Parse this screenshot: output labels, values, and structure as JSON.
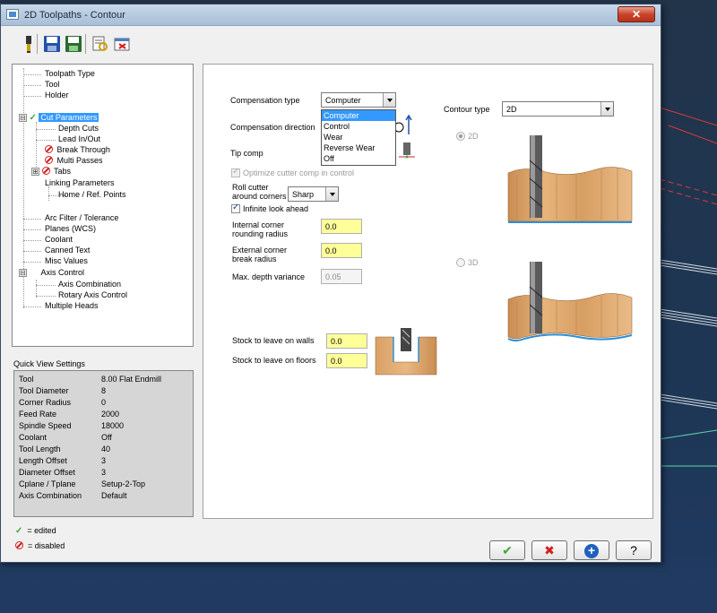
{
  "window": {
    "title": "2D Toolpaths - Contour",
    "close_label": "✕"
  },
  "toolbar": {
    "icons": [
      "tool-icon",
      "save-icon",
      "save-all-icon",
      "preview-icon",
      "calculator-icon"
    ]
  },
  "tree": {
    "items": [
      {
        "label": "Toolpath Type",
        "state": "none"
      },
      {
        "label": "Tool",
        "state": "none"
      },
      {
        "label": "Holder",
        "state": "none"
      },
      {
        "label": "Cut Parameters",
        "state": "edited",
        "selected": true,
        "expander": "⊟"
      },
      {
        "label": "Depth Cuts",
        "state": "none"
      },
      {
        "label": "Lead In/Out",
        "state": "none"
      },
      {
        "label": "Break Through",
        "state": "disabled"
      },
      {
        "label": "Multi Passes",
        "state": "disabled"
      },
      {
        "label": "Tabs",
        "state": "disabled",
        "expander": "⊞"
      },
      {
        "label": "Linking Parameters",
        "state": "none"
      },
      {
        "label": "Home / Ref. Points",
        "state": "none"
      },
      {
        "label": "Arc Filter / Tolerance",
        "state": "none"
      },
      {
        "label": "Planes (WCS)",
        "state": "none"
      },
      {
        "label": "Coolant",
        "state": "none"
      },
      {
        "label": "Canned Text",
        "state": "none"
      },
      {
        "label": "Misc Values",
        "state": "none"
      },
      {
        "label": "Axis Control",
        "state": "none",
        "expander": "⊟"
      },
      {
        "label": "Axis Combination",
        "state": "none"
      },
      {
        "label": "Rotary Axis Control",
        "state": "none"
      },
      {
        "label": "Multiple Heads",
        "state": "none"
      }
    ]
  },
  "quick_view": {
    "title": "Quick View Settings",
    "rows": [
      {
        "label": "Tool",
        "value": "8.00 Flat Endmill"
      },
      {
        "label": "Tool Diameter",
        "value": "8"
      },
      {
        "label": "Corner Radius",
        "value": "0"
      },
      {
        "label": "Feed Rate",
        "value": "2000"
      },
      {
        "label": "Spindle Speed",
        "value": "18000"
      },
      {
        "label": "Coolant",
        "value": "Off"
      },
      {
        "label": "Tool Length",
        "value": "40"
      },
      {
        "label": "Length Offset",
        "value": "3"
      },
      {
        "label": "Diameter Offset",
        "value": "3"
      },
      {
        "label": "Cplane / Tplane",
        "value": "Setup-2-Top"
      },
      {
        "label": "Axis Combination",
        "value": "Default"
      }
    ]
  },
  "legend": {
    "edited": "= edited",
    "disabled": "= disabled"
  },
  "cut_params": {
    "comp_type_label": "Compensation type",
    "comp_type_value": "Computer",
    "comp_type_options": [
      "Computer",
      "Control",
      "Wear",
      "Reverse Wear",
      "Off"
    ],
    "comp_dir_label": "Compensation direction",
    "tip_comp_label": "Tip comp",
    "optimize_label": "Optimize cutter comp in control",
    "roll_cutter_label_1": "Roll cutter",
    "roll_cutter_label_2": "around corners",
    "roll_cutter_value": "Sharp",
    "infinite_look_label": "Infinite look ahead",
    "internal_radius_label_1": "Internal corner",
    "internal_radius_label_2": "rounding radius",
    "internal_radius_value": "0.0",
    "external_radius_label_1": "External corner",
    "external_radius_label_2": "break radius",
    "external_radius_value": "0.0",
    "max_depth_label": "Max. depth variance",
    "max_depth_value": "0.05",
    "stock_walls_label": "Stock to leave on walls",
    "stock_walls_value": "0.0",
    "stock_floors_label": "Stock to leave on floors",
    "stock_floors_value": "0.0",
    "contour_type_label": "Contour type",
    "contour_type_value": "2D",
    "radio_2d": "2D",
    "radio_3d": "3D"
  },
  "buttons": {
    "ok": "✔",
    "cancel": "✖",
    "add": "+",
    "help": "?"
  },
  "colors": {
    "accent": "#3399ff",
    "edited": "#3ea83e",
    "disabled": "#d32020",
    "yellow_field": "#ffff99"
  }
}
